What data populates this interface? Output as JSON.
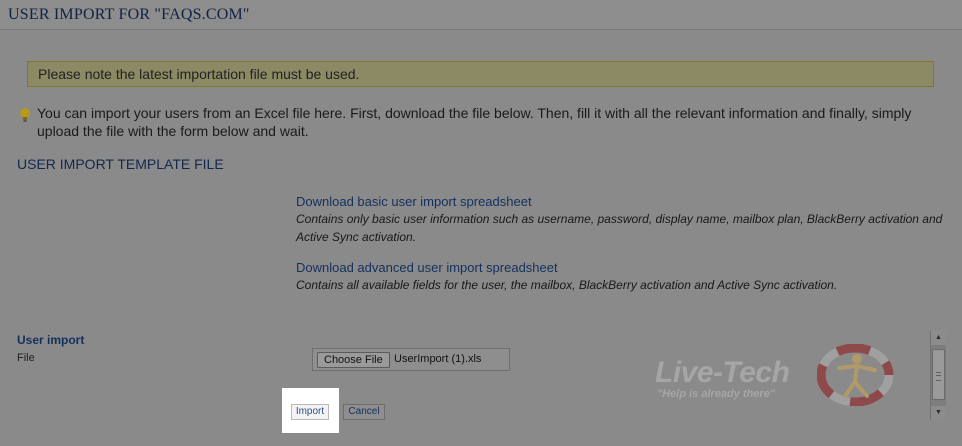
{
  "header": {
    "title": "USER IMPORT FOR \"FAQS.COM\""
  },
  "notice": {
    "text": "Please note the latest importation file must be used."
  },
  "intro": {
    "icon": "lightbulb-icon",
    "text": "You can import your users from an Excel file here. First, download the file below. Then, fill it with all the relevant information and finally, simply upload the file with the form below and wait."
  },
  "template_section": {
    "title": "USER IMPORT TEMPLATE FILE",
    "downloads": [
      {
        "label": "Download basic user import spreadsheet",
        "description": "Contains only basic user information such as username, password, display name, mailbox plan, BlackBerry activation and Active Sync activation."
      },
      {
        "label": "Download advanced user import spreadsheet",
        "description": "Contains all available fields for the user, the mailbox, BlackBerry activation and Active Sync activation."
      }
    ]
  },
  "import_form": {
    "section_label": "User import",
    "file_label": "File",
    "choose_file_button": "Choose File",
    "selected_file": "UserImport (1).xls",
    "import_button": "Import",
    "cancel_button": "Cancel"
  },
  "watermark": {
    "brand": "Live-Tech",
    "tagline": "\"Help is already there\""
  },
  "colors": {
    "overlay_gray": "#8a8a8a",
    "link_blue": "#14305e",
    "notice_bg": "#8c8a64",
    "highlight": "#ffffff"
  }
}
